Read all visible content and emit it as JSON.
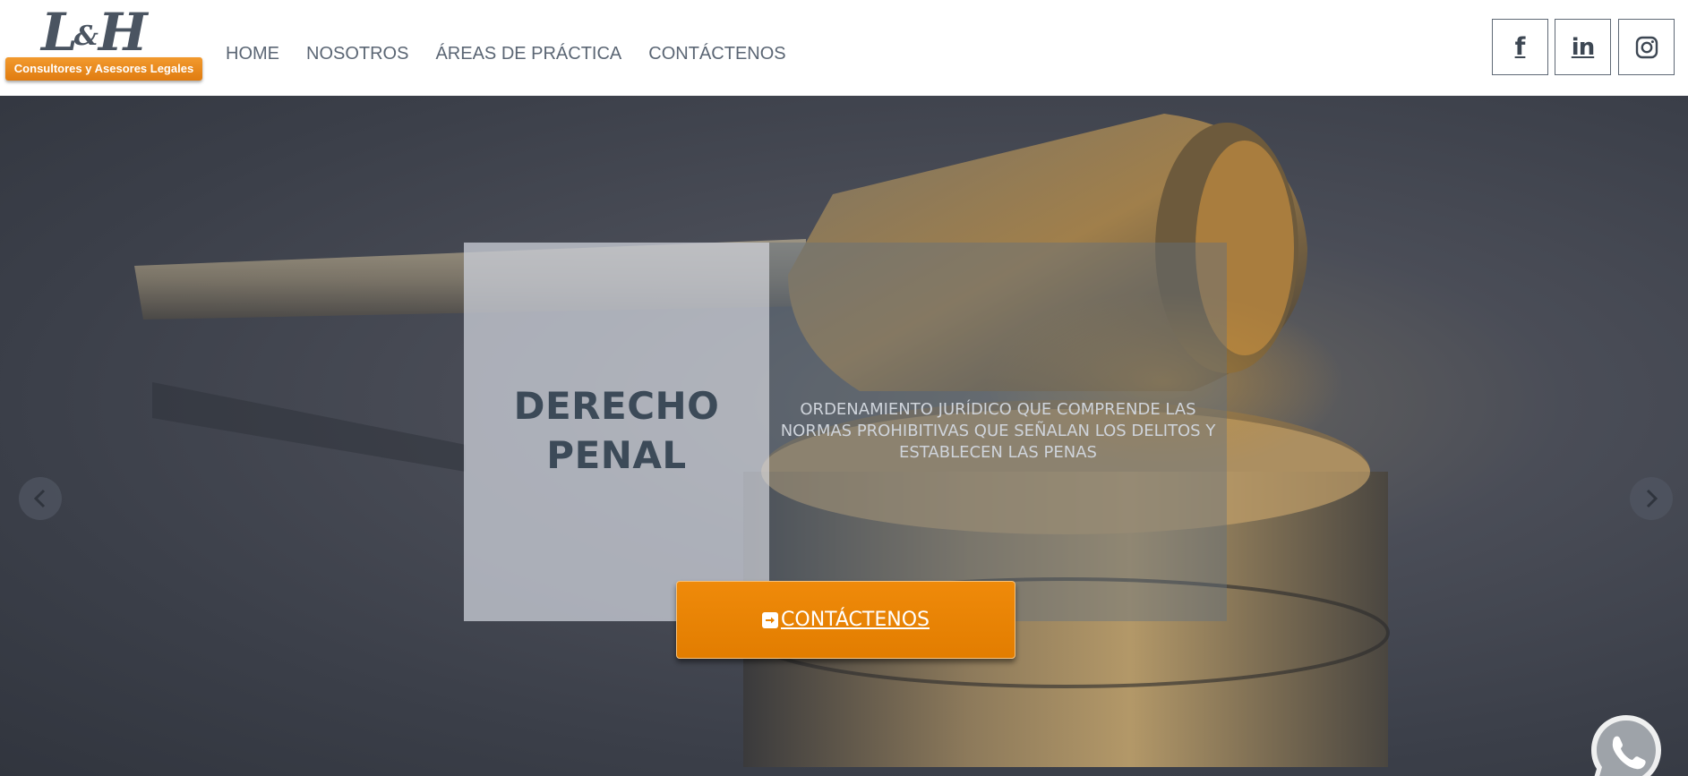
{
  "header": {
    "logo": {
      "mark": "L&H",
      "tagline": "Consultores y Asesores Legales"
    },
    "nav": [
      {
        "label": "HOME"
      },
      {
        "label": "NOSOTROS"
      },
      {
        "label": "ÁREAS DE PRÁCTICA"
      },
      {
        "label": "CONTÁCTENOS"
      }
    ],
    "social": [
      {
        "icon": "facebook-icon"
      },
      {
        "icon": "linkedin-icon"
      },
      {
        "icon": "instagram-icon"
      }
    ]
  },
  "slide": {
    "title_line1": "DERECHO",
    "title_line2": "PENAL",
    "description": "ORDENAMIENTO JURÍDICO QUE COMPRENDE LAS NORMAS PROHIBITIVAS QUE SEÑALAN LOS DELITOS Y ESTABLECEN LAS PENAS",
    "cta_label": "CONTÁCTENOS",
    "cta_icon": "sign-in-icon"
  },
  "carousel": {
    "prev_icon": "chevron-left-icon",
    "next_icon": "chevron-right-icon"
  },
  "floating": {
    "icon": "whatsapp-icon"
  },
  "colors": {
    "accent": "#e98300",
    "nav_text": "#5b6674",
    "title_text": "#3c4a58"
  }
}
